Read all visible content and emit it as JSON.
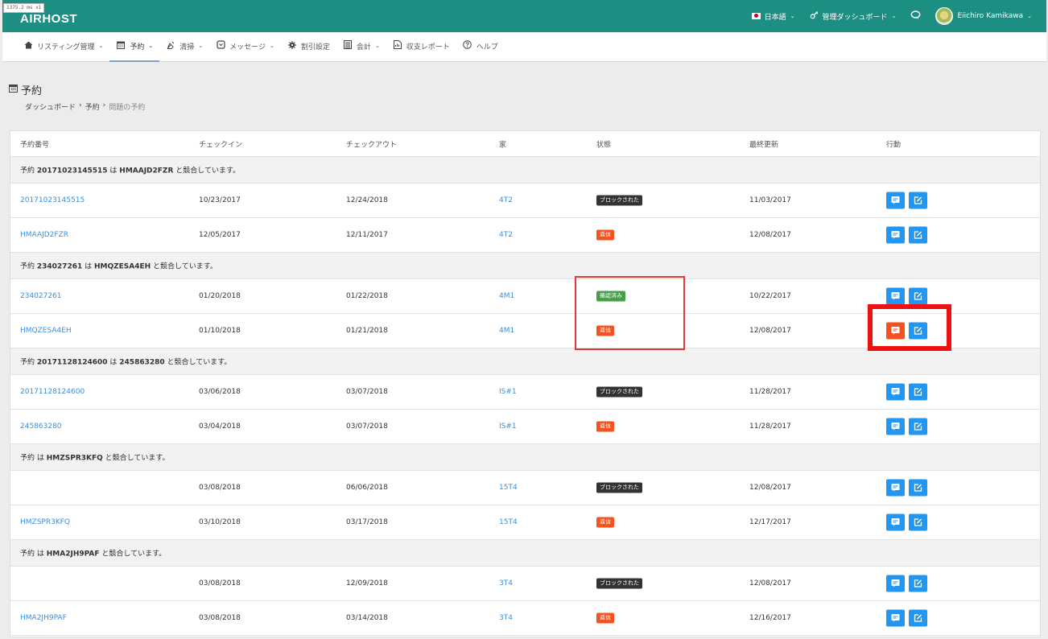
{
  "dev_badge": "1375.2 ms x1",
  "app": {
    "logo": "AIRHOST"
  },
  "topbar": {
    "language": "日本語",
    "dashboard": "管理ダッシュボード",
    "user": "Eiichiro Kamikawa"
  },
  "nav": [
    {
      "label": "リスティング管理",
      "icon": "home-icon",
      "dropdown": true
    },
    {
      "label": "予約",
      "icon": "calendar-icon",
      "dropdown": true,
      "active": true
    },
    {
      "label": "清掃",
      "icon": "broom-icon",
      "dropdown": true
    },
    {
      "label": "メッセージ",
      "icon": "message-icon",
      "dropdown": true
    },
    {
      "label": "割引設定",
      "icon": "gear-icon",
      "dropdown": false
    },
    {
      "label": "会計",
      "icon": "ledger-icon",
      "dropdown": true
    },
    {
      "label": "収支レポート",
      "icon": "report-icon",
      "dropdown": false
    },
    {
      "label": "ヘルプ",
      "icon": "help-icon",
      "dropdown": false
    }
  ],
  "page": {
    "title": "予約",
    "breadcrumb": [
      "ダッシュボード",
      "予約",
      "問題の予約"
    ]
  },
  "table": {
    "headers": [
      "予約番号",
      "チェックイン",
      "チェックアウト",
      "家",
      "状態",
      "最終更新",
      "行動"
    ],
    "groups": [
      {
        "pre": "予約 ",
        "id": "20171023145515",
        "mid": " は ",
        "conflict": "HMAAJD2FZR",
        "post": " と競合しています。",
        "rows": [
          {
            "id": "20171023145515",
            "checkin": "10/23/2017",
            "checkout": "12/24/2018",
            "home": "4T2",
            "status": "ブロックされた",
            "status_type": "blocked",
            "updated": "11/03/2017"
          },
          {
            "id": "HMAAJD2FZR",
            "checkin": "12/05/2017",
            "checkout": "12/11/2017",
            "home": "4T2",
            "status": "返信",
            "status_type": "reply",
            "updated": "12/08/2017"
          }
        ]
      },
      {
        "pre": "予約 ",
        "id": "234027261",
        "mid": " は ",
        "conflict": "HMQZESA4EH",
        "post": " と競合しています。",
        "rows": [
          {
            "id": "234027261",
            "checkin": "01/20/2018",
            "checkout": "01/22/2018",
            "home": "4M1",
            "status": "確認済み",
            "status_type": "confirmed",
            "updated": "10/22/2017"
          },
          {
            "id": "HMQZESA4EH",
            "checkin": "01/10/2018",
            "checkout": "01/21/2018",
            "home": "4M1",
            "status": "返信",
            "status_type": "reply",
            "updated": "12/08/2017",
            "msg_alert": true
          }
        ]
      },
      {
        "pre": "予約 ",
        "id": "20171128124600",
        "mid": " は ",
        "conflict": "245863280",
        "post": " と競合しています。",
        "rows": [
          {
            "id": "20171128124600",
            "checkin": "03/06/2018",
            "checkout": "03/07/2018",
            "home": "IS#1",
            "status": "ブロックされた",
            "status_type": "blocked",
            "updated": "11/28/2017"
          },
          {
            "id": "245863280",
            "checkin": "03/04/2018",
            "checkout": "03/07/2018",
            "home": "IS#1",
            "status": "返信",
            "status_type": "reply",
            "updated": "11/28/2017"
          }
        ]
      },
      {
        "pre": "予約 ",
        "id": "",
        "mid": "は ",
        "conflict": "HMZSPR3KFQ",
        "post": " と競合しています。",
        "rows": [
          {
            "id": "",
            "checkin": "03/08/2018",
            "checkout": "06/06/2018",
            "home": "15T4",
            "status": "ブロックされた",
            "status_type": "blocked",
            "updated": "12/08/2017"
          },
          {
            "id": "HMZSPR3KFQ",
            "checkin": "03/10/2018",
            "checkout": "03/17/2018",
            "home": "15T4",
            "status": "返信",
            "status_type": "reply",
            "updated": "12/17/2017"
          }
        ]
      },
      {
        "pre": "予約 ",
        "id": "",
        "mid": "は ",
        "conflict": "HMA2JH9PAF",
        "post": " と競合しています。",
        "rows": [
          {
            "id": "",
            "checkin": "03/08/2018",
            "checkout": "12/09/2018",
            "home": "3T4",
            "status": "ブロックされた",
            "status_type": "blocked",
            "updated": "12/08/2017"
          },
          {
            "id": "HMA2JH9PAF",
            "checkin": "03/08/2018",
            "checkout": "03/14/2018",
            "home": "3T4",
            "status": "返信",
            "status_type": "reply",
            "updated": "12/16/2017"
          }
        ]
      }
    ]
  },
  "colors": {
    "brand": "#1d8f82",
    "link": "#3a8fd9",
    "action": "#2196f3",
    "alert": "#f4511e",
    "confirmed": "#43a047",
    "highlight": "#ee1111"
  }
}
